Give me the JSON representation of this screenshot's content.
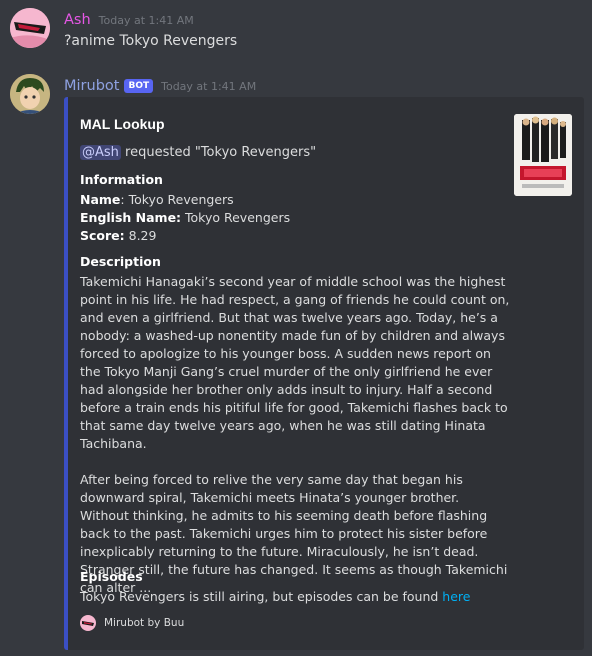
{
  "messages": [
    {
      "author": "Ash",
      "author_color": "#e557e5",
      "timestamp": "Today at 1:41 AM",
      "content": "?anime Tokyo Revengers"
    },
    {
      "author": "Mirubot",
      "author_color": "#8ea1e1",
      "badge": "BOT",
      "timestamp": "Today at 1:41 AM"
    }
  ],
  "embed": {
    "accent": "#3b4fc4",
    "title": "MAL Lookup",
    "mention": "@Ash",
    "request_text": " requested \"Tokyo Revengers\"",
    "info_heading": "Information",
    "name_label": "Name",
    "name_value": ": Tokyo Revengers",
    "english_label": "English Name:",
    "english_value": " Tokyo Revengers",
    "score_label": "Score:",
    "score_value": " 8.29",
    "desc_heading": "Description",
    "description": "Takemichi Hanagaki’s second year of middle school was the highest point in his life. He had respect, a gang of friends he could count on, and even a girlfriend. But that was twelve years ago. Today, he’s a nobody: a washed-up nonentity made fun of by children and always forced to apologize to his younger boss. A sudden news report on the Tokyo Manji Gang’s cruel murder of the only girlfriend he ever had alongside her brother only adds insult to injury. Half a second before a train ends his pitiful life for good, Takemichi flashes back to that same day twelve years ago, when he was still dating Hinata Tachibana.\n\nAfter being forced to relive the very same day that began his downward spiral, Takemichi meets Hinata’s younger brother. Without thinking, he admits to his seeming death before flashing back to the past. Takemichi urges him to protect his sister before inexplicably returning to the future. Miraculously, he isn’t dead. Stranger still, the future has changed. It seems as though Takemichi can alter ...",
    "episodes_heading": "Episodes",
    "episodes_text": "Tokyo Revengers is still airing, but episodes can be found ",
    "episodes_link": "here",
    "footer_text": "Mirubot by Buu"
  }
}
